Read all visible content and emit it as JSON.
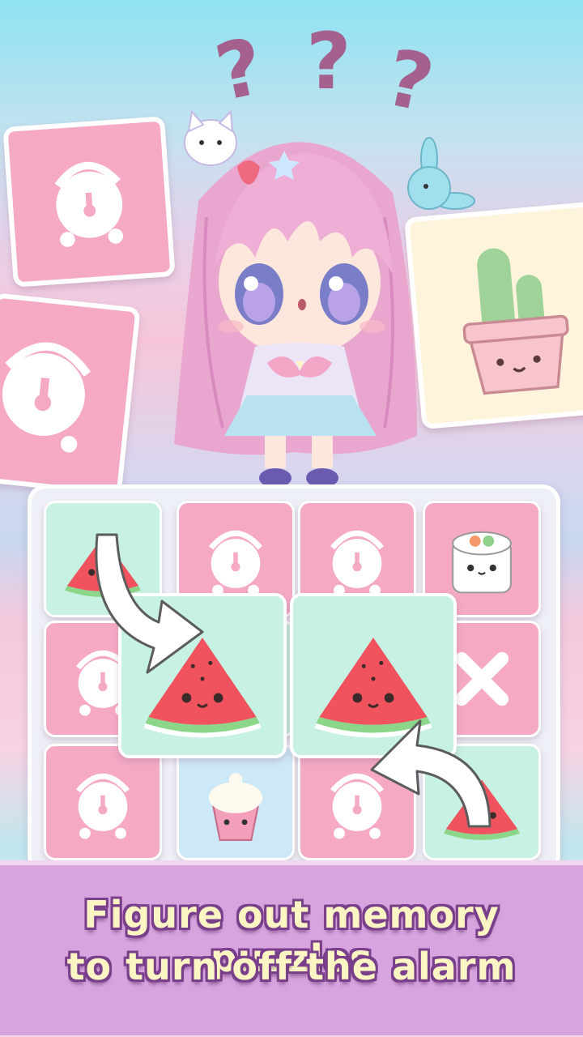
{
  "caption": {
    "line1": "Figure out memory puzzles",
    "line2": "to turn off the alarm"
  },
  "question_marks": [
    "?",
    "?",
    "?"
  ],
  "board": {
    "rows": 3,
    "cols": 4,
    "tiles": [
      [
        "watermelon",
        "alarm-clock",
        "alarm-clock",
        "sushi"
      ],
      [
        "alarm-clock",
        "watermelon",
        "watermelon",
        "x-mark"
      ],
      [
        "alarm-clock",
        "cupcake",
        "alarm-clock",
        "watermelon"
      ]
    ]
  },
  "colors": {
    "card_pink": "#f5a9c5",
    "card_mint": "#c6f1e3",
    "banner": "#d8a4df",
    "caption_text": "#fbf5c4",
    "caption_outline": "#7a3f8a"
  }
}
